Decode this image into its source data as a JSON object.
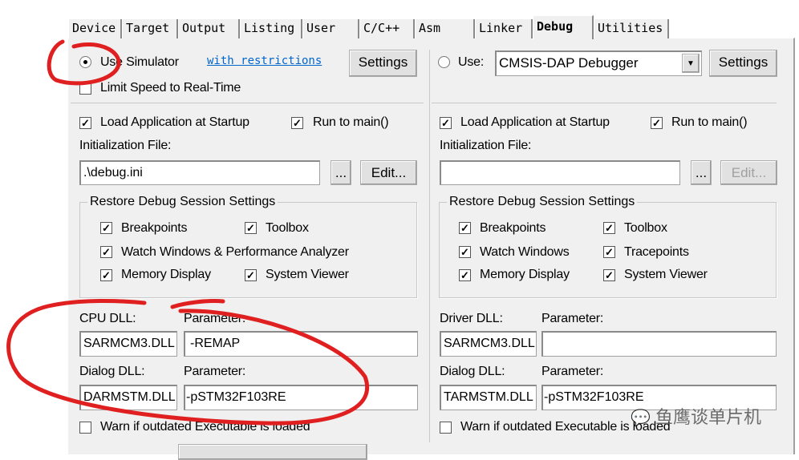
{
  "tabs": [
    "Device",
    "Target",
    "Output",
    "Listing",
    "User",
    "C/C++",
    "Asm",
    "Linker",
    "Debug",
    "Utilities"
  ],
  "active_tab": "Debug",
  "left": {
    "use_simulator_label": "Use Simulator",
    "use_simulator_selected": true,
    "restrictions_link": "with restrictions",
    "settings_label": "Settings",
    "limit_speed_label": "Limit Speed to Real-Time",
    "limit_speed_checked": false,
    "load_app_label": "Load Application at Startup",
    "load_app_checked": true,
    "run_to_main_label": "Run to main()",
    "run_to_main_checked": true,
    "init_file_label": "Initialization File:",
    "init_file_value": ".\\debug.ini",
    "browse_label": "...",
    "edit_label": "Edit...",
    "restore_group_title": "Restore Debug Session Settings",
    "restore_items": [
      {
        "label": "Breakpoints",
        "checked": true
      },
      {
        "label": "Toolbox",
        "checked": true
      },
      {
        "label": "Watch Windows & Performance Analyzer",
        "checked": true
      },
      {
        "label": "Memory Display",
        "checked": true
      },
      {
        "label": "System Viewer",
        "checked": true
      }
    ],
    "cpu_dll_label": "CPU DLL:",
    "cpu_dll_value": "SARMCM3.DLL",
    "cpu_param_label": "Parameter:",
    "cpu_param_value": "-REMAP",
    "dialog_dll_label": "Dialog DLL:",
    "dialog_dll_value": "DARMSTM.DLL",
    "dialog_param_label": "Parameter:",
    "dialog_param_value": "-pSTM32F103RE",
    "warn_label": "Warn if outdated Executable is loaded",
    "warn_checked": false
  },
  "right": {
    "use_label": "Use:",
    "use_selected": false,
    "debugger_value": "CMSIS-DAP Debugger",
    "settings_label": "Settings",
    "load_app_label": "Load Application at Startup",
    "load_app_checked": true,
    "run_to_main_label": "Run to main()",
    "run_to_main_checked": true,
    "init_file_label": "Initialization File:",
    "init_file_value": "",
    "browse_label": "...",
    "edit_label": "Edit...",
    "restore_group_title": "Restore Debug Session Settings",
    "restore_items": [
      {
        "label": "Breakpoints",
        "checked": true
      },
      {
        "label": "Toolbox",
        "checked": true
      },
      {
        "label": "Watch Windows",
        "checked": true
      },
      {
        "label": "Tracepoints",
        "checked": true
      },
      {
        "label": "Memory Display",
        "checked": true
      },
      {
        "label": "System Viewer",
        "checked": true
      }
    ],
    "driver_dll_label": "Driver DLL:",
    "driver_dll_value": "SARMCM3.DLL",
    "driver_param_label": "Parameter:",
    "driver_param_value": "",
    "dialog_dll_label": "Dialog DLL:",
    "dialog_dll_value": "TARMSTM.DLL",
    "dialog_param_label": "Parameter:",
    "dialog_param_value": "-pSTM32F103RE",
    "warn_label": "Warn if outdated Executable is loaded",
    "warn_checked": false
  },
  "watermark": "鱼鹰谈单片机",
  "annotation_color": "#e02020"
}
